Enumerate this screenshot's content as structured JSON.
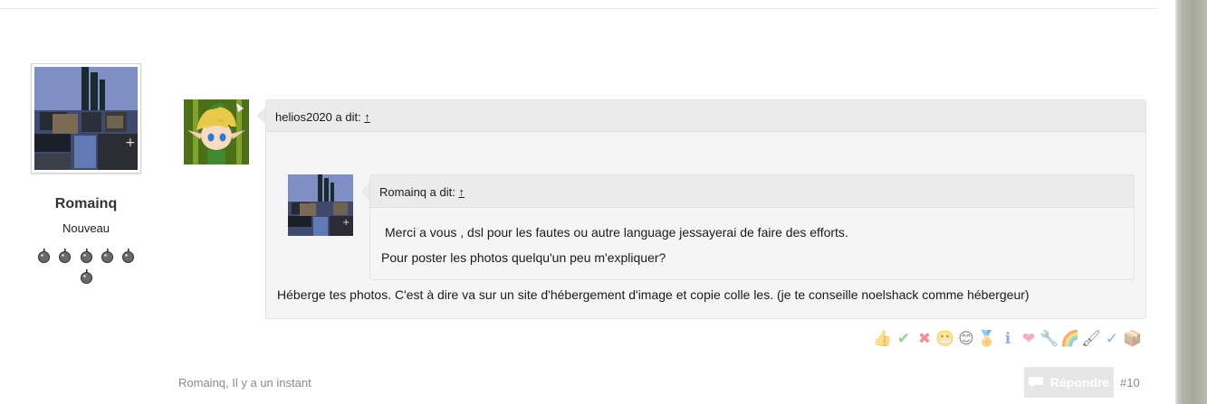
{
  "author": {
    "name": "Romainq",
    "rank": "Nouveau",
    "badge_count": 6,
    "badge_icon": "apple-icon"
  },
  "quote_outer": {
    "header_text": "helios2020 a dit: ",
    "up_link": "↑"
  },
  "quote_inner": {
    "header_text": "Romainq a dit: ",
    "up_link": "↑",
    "line1": "Merci a vous , dsl pour les fautes ou autre language jessayerai de faire des efforts.",
    "line2": "Pour poster les photos quelqu'un peu m'expliquer?"
  },
  "reply_text": "Héberge tes photos. C'est à dire va sur un site d'hébergement d'image et copie colle les. (je te conseille noelshack comme hébergeur)",
  "reactions": [
    {
      "icon": "thumbs-up-icon",
      "glyph": "👍"
    },
    {
      "icon": "check-icon",
      "glyph": "✔"
    },
    {
      "icon": "cross-icon",
      "glyph": "✖"
    },
    {
      "icon": "troll-face-icon",
      "glyph": "😬"
    },
    {
      "icon": "smile-icon",
      "glyph": "😊"
    },
    {
      "icon": "award-icon",
      "glyph": "🏅"
    },
    {
      "icon": "info-icon",
      "glyph": "ℹ"
    },
    {
      "icon": "heart-icon",
      "glyph": "❤"
    },
    {
      "icon": "wrench-icon",
      "glyph": "🔧"
    },
    {
      "icon": "rainbow-icon",
      "glyph": "🌈"
    },
    {
      "icon": "paintbrush-icon",
      "glyph": "🖌"
    },
    {
      "icon": "spellcheck-icon",
      "glyph": "✓"
    },
    {
      "icon": "box-icon",
      "glyph": "📦"
    }
  ],
  "footer": {
    "meta": "Romainq, Il y a un instant",
    "reply_label": "Répondre",
    "post_number": "#10"
  },
  "colors": {
    "panel_bg": "#f5f5f5",
    "panel_header_bg": "#ebebeb",
    "reply_button_bg": "#e6e6e6"
  }
}
